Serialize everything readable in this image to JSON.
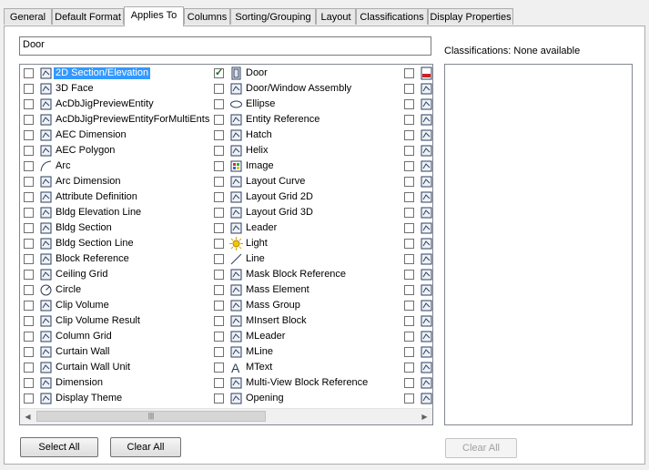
{
  "tabs": [
    {
      "label": "General"
    },
    {
      "label": "Default Format"
    },
    {
      "label": "Applies To"
    },
    {
      "label": "Columns"
    },
    {
      "label": "Sorting/Grouping"
    },
    {
      "label": "Layout"
    },
    {
      "label": "Classifications"
    },
    {
      "label": "Display Properties"
    }
  ],
  "active_tab": "Applies To",
  "search": {
    "value": "Door"
  },
  "objects": {
    "column1": [
      {
        "label": "2D Section/Elevation",
        "icon": "section-elevation-icon",
        "checked": false,
        "selected": true
      },
      {
        "label": "3D Face",
        "icon": "3d-face-icon",
        "checked": false
      },
      {
        "label": "AcDbJigPreviewEntity",
        "icon": "entity-icon",
        "checked": false
      },
      {
        "label": "AcDbJigPreviewEntityForMultiEnts",
        "icon": "entity-icon",
        "checked": false
      },
      {
        "label": "AEC Dimension",
        "icon": "aec-dimension-icon",
        "checked": false
      },
      {
        "label": "AEC Polygon",
        "icon": "polygon-icon",
        "checked": false
      },
      {
        "label": "Arc",
        "icon": "arc-icon",
        "checked": false
      },
      {
        "label": "Arc Dimension",
        "icon": "arc-dimension-icon",
        "checked": false
      },
      {
        "label": "Attribute Definition",
        "icon": "attribute-icon",
        "checked": false
      },
      {
        "label": "Bldg Elevation Line",
        "icon": "elevation-line-icon",
        "checked": false
      },
      {
        "label": "Bldg Section",
        "icon": "bldg-section-icon",
        "checked": false
      },
      {
        "label": "Bldg Section Line",
        "icon": "section-line-icon",
        "checked": false
      },
      {
        "label": "Block Reference",
        "icon": "block-icon",
        "checked": false
      },
      {
        "label": "Ceiling Grid",
        "icon": "ceiling-grid-icon",
        "checked": false
      },
      {
        "label": "Circle",
        "icon": "circle-icon",
        "checked": false
      },
      {
        "label": "Clip Volume",
        "icon": "clip-volume-icon",
        "checked": false
      },
      {
        "label": "Clip Volume Result",
        "icon": "clip-volume-result-icon",
        "checked": false
      },
      {
        "label": "Column Grid",
        "icon": "column-grid-icon",
        "checked": false
      },
      {
        "label": "Curtain Wall",
        "icon": "curtain-wall-icon",
        "checked": false
      },
      {
        "label": "Curtain Wall Unit",
        "icon": "curtain-wall-unit-icon",
        "checked": false
      },
      {
        "label": "Dimension",
        "icon": "dimension-icon",
        "checked": false
      },
      {
        "label": "Display Theme",
        "icon": "display-theme-icon",
        "checked": false
      }
    ],
    "column2": [
      {
        "label": "Door",
        "icon": "door-icon",
        "checked": true
      },
      {
        "label": "Door/Window Assembly",
        "icon": "door-window-assembly-icon",
        "checked": false
      },
      {
        "label": "Ellipse",
        "icon": "ellipse-icon",
        "checked": false
      },
      {
        "label": "Entity Reference",
        "icon": "entity-reference-icon",
        "checked": false
      },
      {
        "label": "Hatch",
        "icon": "hatch-icon",
        "checked": false
      },
      {
        "label": "Helix",
        "icon": "helix-icon",
        "checked": false
      },
      {
        "label": "Image",
        "icon": "image-icon",
        "checked": false
      },
      {
        "label": "Layout Curve",
        "icon": "layout-curve-icon",
        "checked": false
      },
      {
        "label": "Layout Grid 2D",
        "icon": "layout-grid-2d-icon",
        "checked": false
      },
      {
        "label": "Layout Grid 3D",
        "icon": "layout-grid-3d-icon",
        "checked": false
      },
      {
        "label": "Leader",
        "icon": "leader-icon",
        "checked": false
      },
      {
        "label": "Light",
        "icon": "light-icon",
        "checked": false
      },
      {
        "label": "Line",
        "icon": "line-icon",
        "checked": false
      },
      {
        "label": "Mask Block Reference",
        "icon": "mask-block-icon",
        "checked": false
      },
      {
        "label": "Mass Element",
        "icon": "mass-element-icon",
        "checked": false
      },
      {
        "label": "Mass Group",
        "icon": "mass-group-icon",
        "checked": false
      },
      {
        "label": "MInsert Block",
        "icon": "minsert-block-icon",
        "checked": false
      },
      {
        "label": "MLeader",
        "icon": "mleader-icon",
        "checked": false
      },
      {
        "label": "MLine",
        "icon": "mline-icon",
        "checked": false
      },
      {
        "label": "MText",
        "icon": "mtext-icon",
        "checked": false
      },
      {
        "label": "Multi-View Block Reference",
        "icon": "multi-view-block-icon",
        "checked": false
      },
      {
        "label": "Opening",
        "icon": "opening-icon",
        "checked": false
      }
    ],
    "column3_icons": [
      "pdf-icon",
      "point-icon",
      "polyline-icon",
      "polyface-icon",
      "railing-icon",
      "ramp-icon",
      "roof-icon",
      "roof-slab-icon",
      "ray-icon",
      "region-icon",
      "section-icon",
      "shell-icon",
      "slab-icon",
      "space-icon",
      "stair-icon",
      "structural-member-icon",
      "surface-icon",
      "table-icon",
      "tolerance-icon",
      "torus-icon",
      "spline-icon",
      "wall-icon"
    ]
  },
  "classifications": {
    "label": "Classifications: None available"
  },
  "buttons": {
    "select_all": "Select All",
    "clear_all": "Clear All",
    "clear_all_classifications": "Clear All"
  },
  "colors": {
    "selection": "#3399ff",
    "check": "#1c6b1c",
    "panel_border": "#adadad"
  }
}
